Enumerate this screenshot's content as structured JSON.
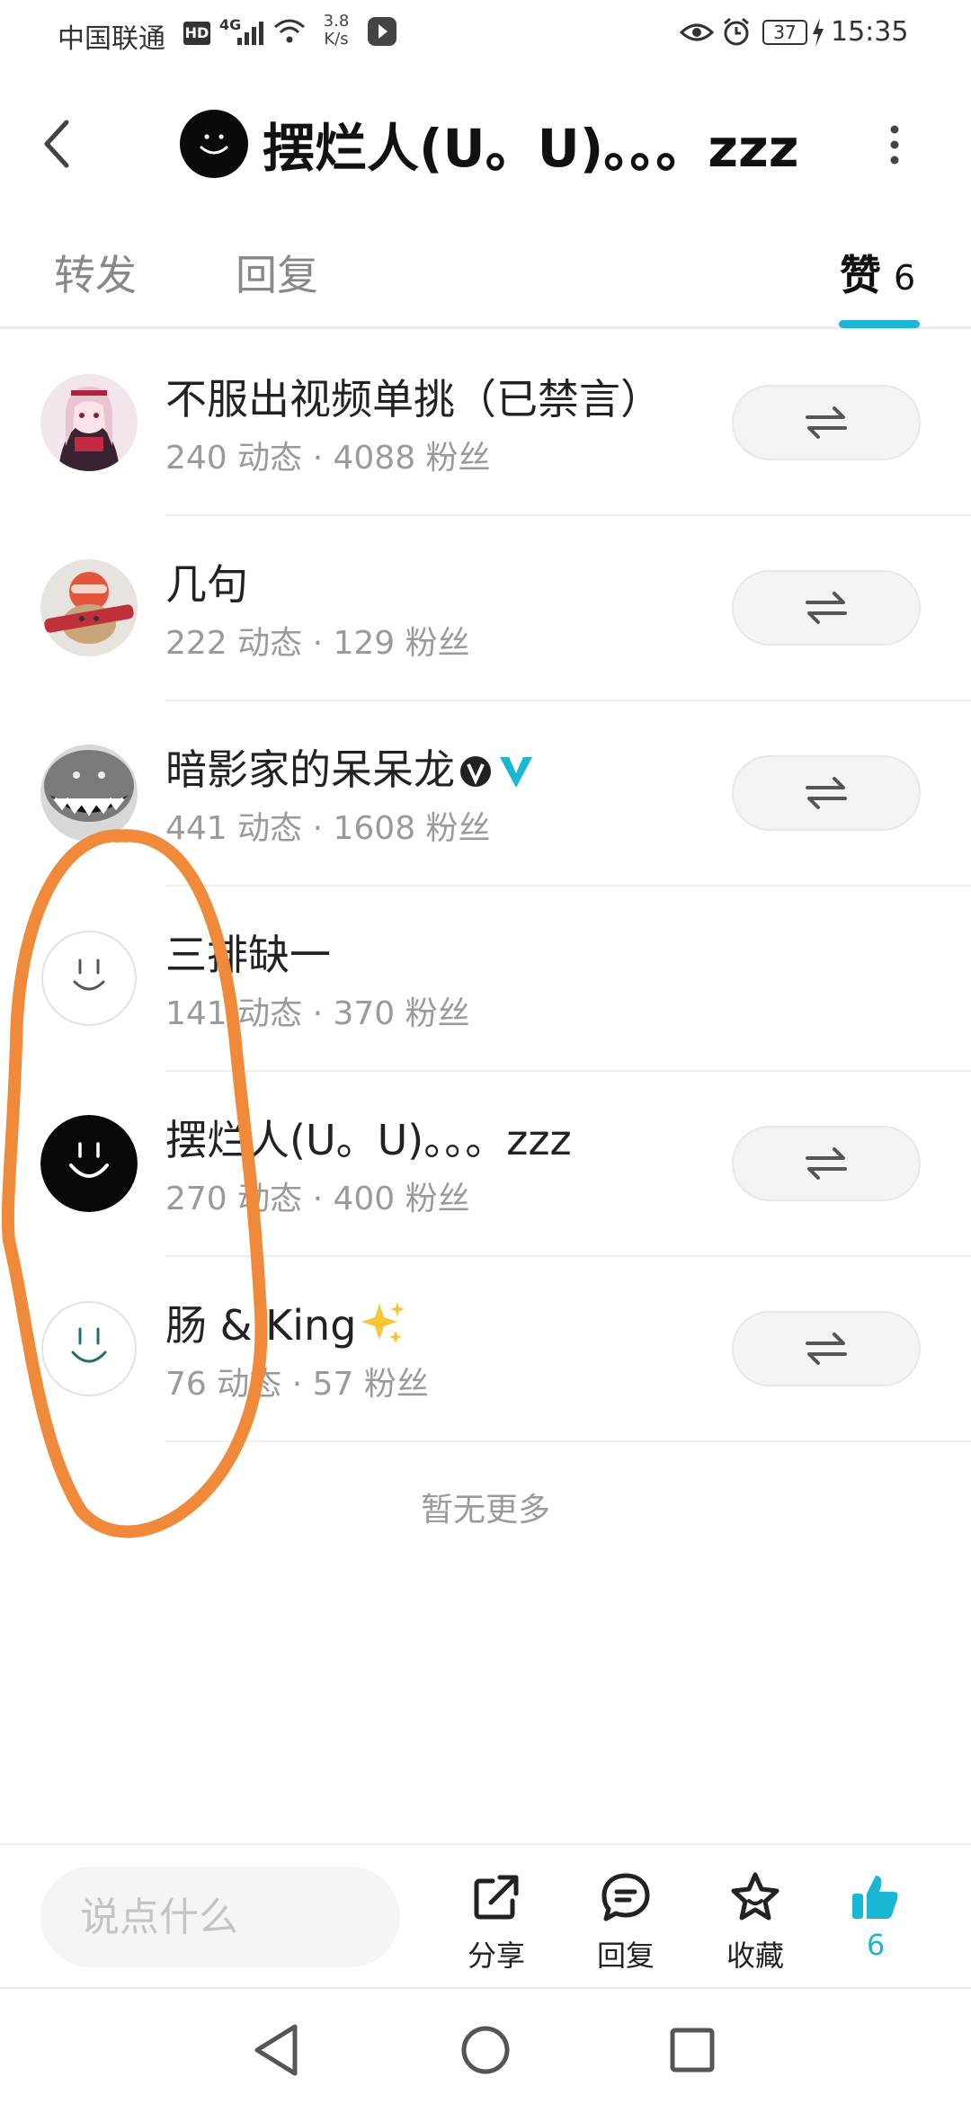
{
  "status_bar": {
    "carrier": "中国联通",
    "hd_badge": "HD",
    "network": "4G",
    "speed_value": "3.8",
    "speed_unit": "K/s",
    "battery": "37",
    "time": "15:35"
  },
  "header": {
    "title": "摆烂人(U。U)。。。zzz"
  },
  "tabs": {
    "repost": "转发",
    "reply": "回复",
    "like": "赞",
    "like_count": "6"
  },
  "list": [
    {
      "name": "不服出视频单挑（已禁言）",
      "stats": "240 动态 · 4088 粉丝",
      "has_repost_button": true
    },
    {
      "name": "几句",
      "stats": "222 动态 · 129 粉丝",
      "has_repost_button": true
    },
    {
      "name": "暗影家的呆呆龙",
      "stats": "441 动态 · 1608 粉丝",
      "has_repost_button": true
    },
    {
      "name": "三排缺一",
      "stats": "141 动态 · 370 粉丝",
      "has_repost_button": false
    },
    {
      "name": "摆烂人(U。U)。。。zzz",
      "stats": "270 动态 · 400 粉丝",
      "has_repost_button": true
    },
    {
      "name": "肠 & King",
      "stats": "76 动态 · 57 粉丝",
      "has_repost_button": true
    }
  ],
  "no_more_text": "暂无更多",
  "bottom_bar": {
    "comment_placeholder": "说点什么",
    "share": "分享",
    "reply": "回复",
    "favorite": "收藏",
    "like_count": "6"
  },
  "colors": {
    "accent": "#1ab6d3",
    "annotation": "#f08a3a"
  }
}
